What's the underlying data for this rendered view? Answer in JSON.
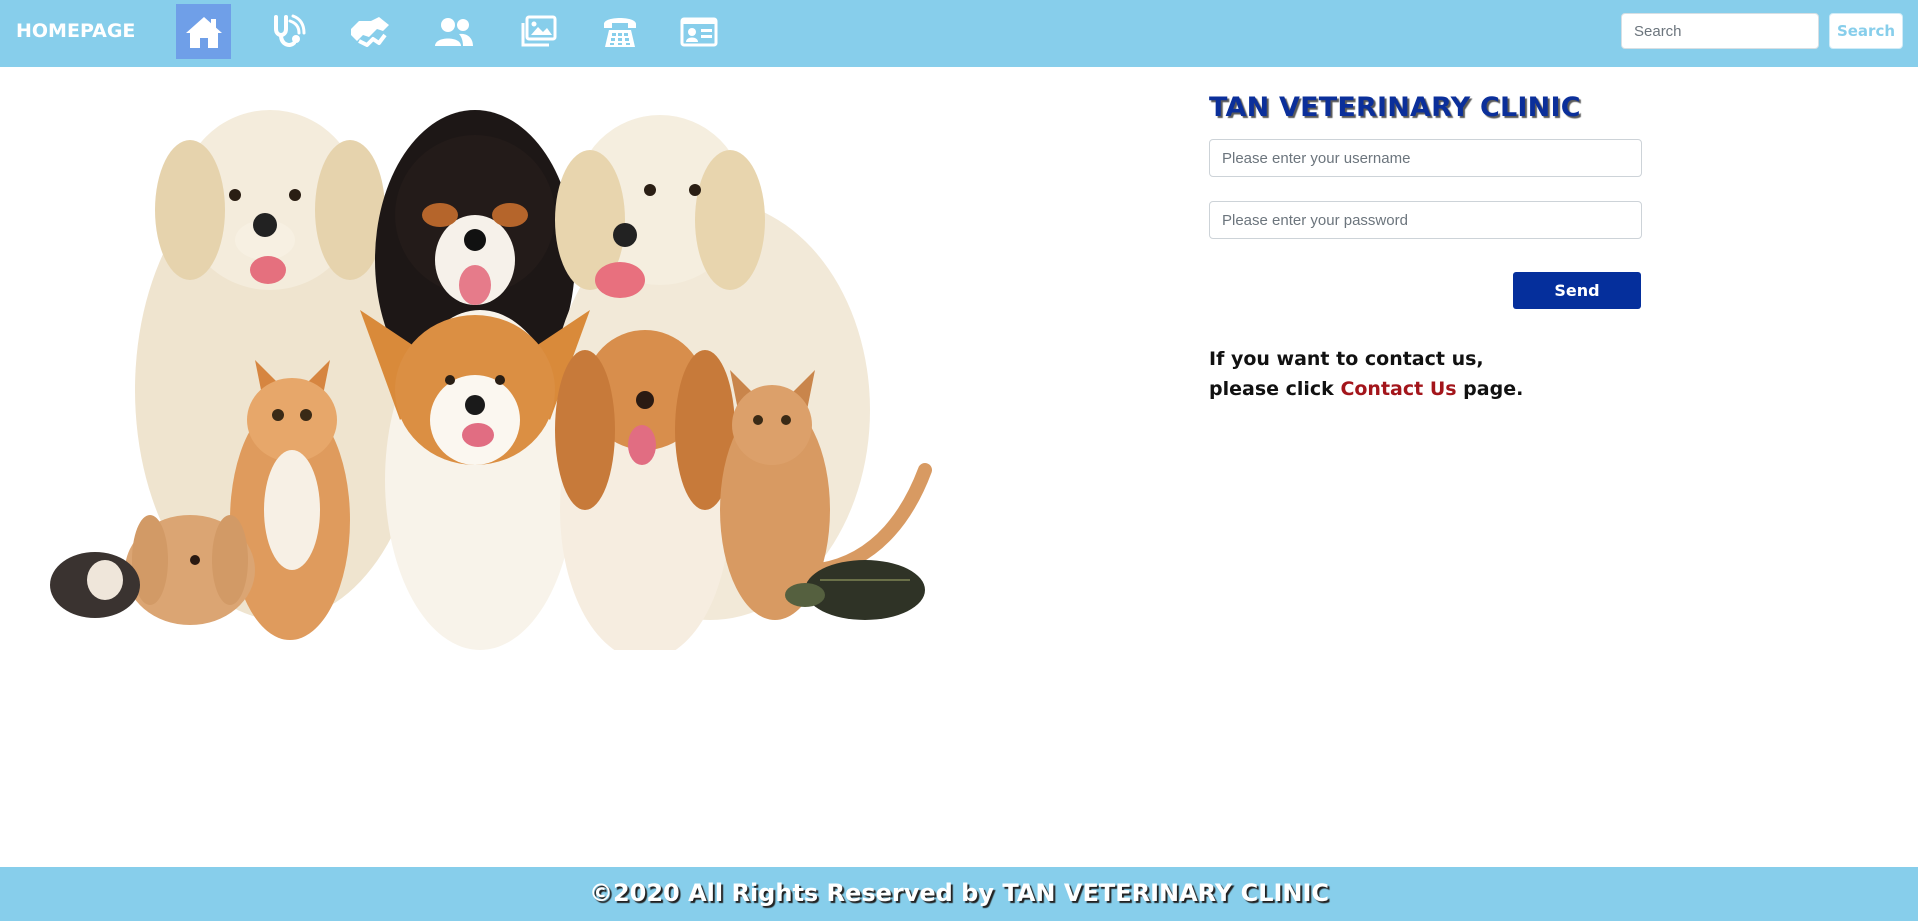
{
  "nav": {
    "brand": "HOMEPAGE",
    "icons": [
      {
        "name": "home-icon",
        "active": true
      },
      {
        "name": "stethoscope-icon",
        "active": false
      },
      {
        "name": "handshake-icon",
        "active": false
      },
      {
        "name": "users-icon",
        "active": false
      },
      {
        "name": "images-icon",
        "active": false
      },
      {
        "name": "phone-icon",
        "active": false
      },
      {
        "name": "id-card-icon",
        "active": false
      }
    ],
    "search_placeholder": "Search",
    "search_button": "Search"
  },
  "hero": {
    "image": "pets-group-photo"
  },
  "login": {
    "title": "TAN VETERINARY CLINIC",
    "username_placeholder": "Please enter your username",
    "password_placeholder": "Please enter your password",
    "send_label": "Send"
  },
  "contact": {
    "line1": "If you want to contact us,",
    "prefix": "please click ",
    "link": "Contact Us",
    "suffix": " page."
  },
  "footer": {
    "text": "©2020 All Rights Reserved by TAN VETERINARY CLINIC"
  },
  "colors": {
    "nav_bg": "#87ceeb",
    "active_nav": "#6f9fe8",
    "title": "#0b2f9a",
    "send_button": "#052f9c",
    "link": "#a3151b"
  }
}
